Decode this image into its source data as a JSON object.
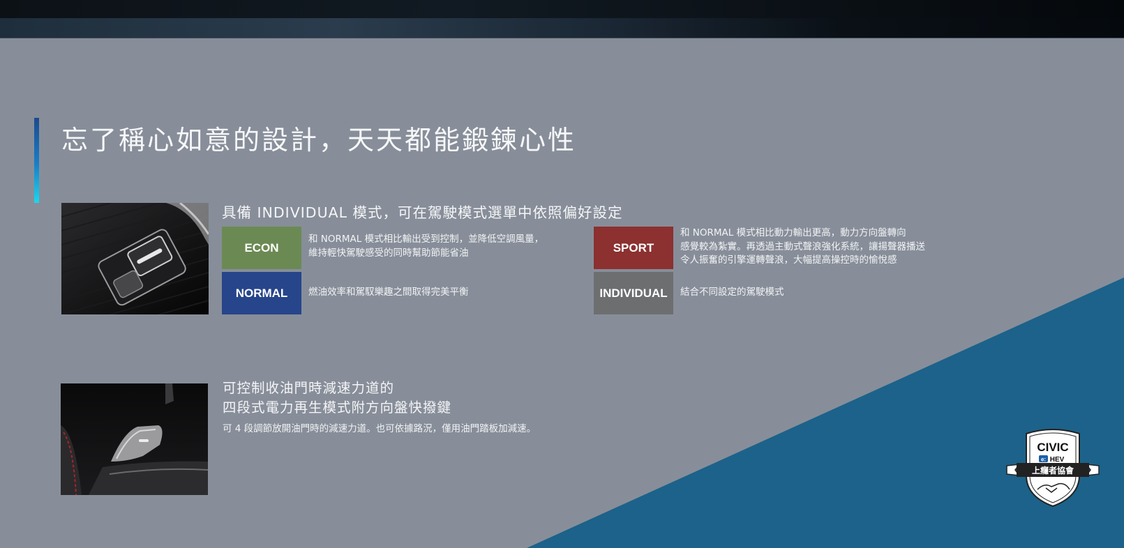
{
  "page": {
    "title": "忘了稱心如意的設計，天天都能鍛鍊心性"
  },
  "drive_modes": {
    "heading": "具備 INDIVIDUAL 模式，可在駕駛模式選單中依照偏好設定",
    "modes": [
      {
        "name": "ECON",
        "color": "#6b8a53",
        "description": [
          "和 NORMAL 模式相比輸出受到控制，並降低空調風量，",
          "維持輕快駕駛感受的同時幫助節能省油"
        ]
      },
      {
        "name": "SPORT",
        "color": "#8c3030",
        "description": [
          "和 NORMAL 模式相比動力輸出更高，動力方向盤轉向",
          "感覺較為紮實。再透過主動式聲浪強化系統，讓揚聲器播送",
          "令人振奮的引擎運轉聲浪，大幅提高操控時的愉悅感"
        ]
      },
      {
        "name": "NORMAL",
        "color": "#27458a",
        "description": [
          "燃油效率和駕馭樂趣之間取得完美平衡"
        ]
      },
      {
        "name": "INDIVIDUAL",
        "color": "#6d6e70",
        "description": [
          "結合不同設定的駕駛模式"
        ]
      }
    ]
  },
  "paddle_shift": {
    "heading_lines": [
      "可控制收油門時減速力道的",
      "四段式電力再生模式附方向盤快撥鍵"
    ],
    "description": "可 4 段調節放開油門時的減速力道。也可依據路況，僅用油門踏板加減速。"
  },
  "badge": {
    "brand": "CIVIC",
    "sub_prefix": "e:",
    "sub": "HEV",
    "ribbon": "上癮者協會"
  },
  "colors": {
    "background": "#878e99",
    "diagonal": "#1c628a",
    "accent_top": "#1b4a8e",
    "accent_bottom": "#19d8f0"
  }
}
